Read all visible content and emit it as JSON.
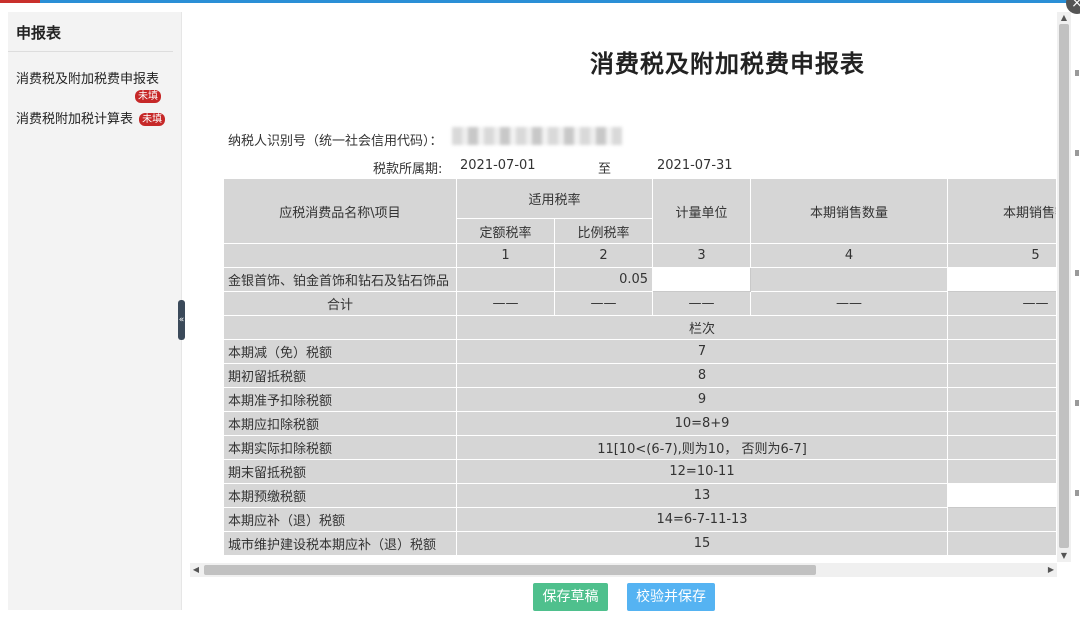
{
  "window": {
    "close_icon": "×",
    "collapse_icon": "«"
  },
  "sidebar": {
    "title": "申报表",
    "items": [
      {
        "label": "消费税及附加税费申报表",
        "badge": "未填"
      },
      {
        "label": "消费税附加税计算表",
        "badge": "未填"
      }
    ]
  },
  "form": {
    "title": "消费税及附加税费申报表",
    "taxpayer_id_label": "纳税人识别号（统一社会信用代码）：",
    "period_label": "税款所属期:",
    "period_start": "2021-07-01",
    "period_to": "至",
    "period_end": "2021-07-31",
    "headers": {
      "item": "应税消费品名称\\项目",
      "rate": "适用税率",
      "fixed_rate": "定额税率",
      "prop_rate": "比例税率",
      "unit": "计量单位",
      "qty": "本期销售数量",
      "sales": "本期销售额"
    },
    "col_numbers": [
      "1",
      "2",
      "3",
      "4",
      "5"
    ],
    "product_row": {
      "name": "金银首饰、铂金首饰和钻石及钻石饰品",
      "prop_rate": "0.05"
    },
    "total_row": {
      "name": "合计",
      "dash": "——"
    },
    "lan_header": "栏次",
    "rows": [
      {
        "label": "本期减（免）税额",
        "lan": "7"
      },
      {
        "label": "期初留抵税额",
        "lan": "8"
      },
      {
        "label": "本期准予扣除税额",
        "lan": "9"
      },
      {
        "label": "本期应扣除税额",
        "lan": "10=8+9"
      },
      {
        "label": "本期实际扣除税额",
        "lan": "11[10<(6-7),则为10， 否则为6-7]"
      },
      {
        "label": "期末留抵税额",
        "lan": "12=10-11"
      },
      {
        "label": "本期预缴税额",
        "lan": "13"
      },
      {
        "label": "本期应补（退）税额",
        "lan": "14=6-7-11-13"
      },
      {
        "label": "城市维护建设税本期应补（退）税额",
        "lan": "15"
      }
    ]
  },
  "buttons": {
    "save_draft": "保存草稿",
    "validate_save": "校验并保存"
  },
  "scroll": {
    "up": "▲",
    "down": "▼",
    "left": "◀",
    "right": "▶"
  }
}
